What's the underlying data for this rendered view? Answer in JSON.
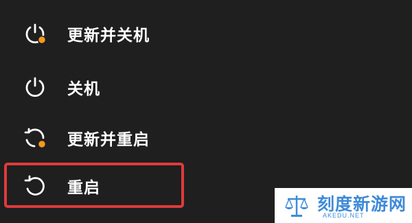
{
  "power_menu": {
    "items": [
      {
        "label": "更新并关机",
        "icon": "power-update-icon"
      },
      {
        "label": "关机",
        "icon": "power-icon"
      },
      {
        "label": "更新并重启",
        "icon": "restart-update-icon"
      },
      {
        "label": "重启",
        "icon": "restart-icon"
      }
    ]
  },
  "highlight": {
    "target": "restart",
    "color": "#e03a3a"
  },
  "watermark": {
    "title": "刻度新游网",
    "subtitle": "AKEDU.NET",
    "color": "#3f8ad8"
  },
  "colors": {
    "background": "#1f1f1f",
    "text": "#ffffff",
    "update_badge": "#f59a1b"
  }
}
